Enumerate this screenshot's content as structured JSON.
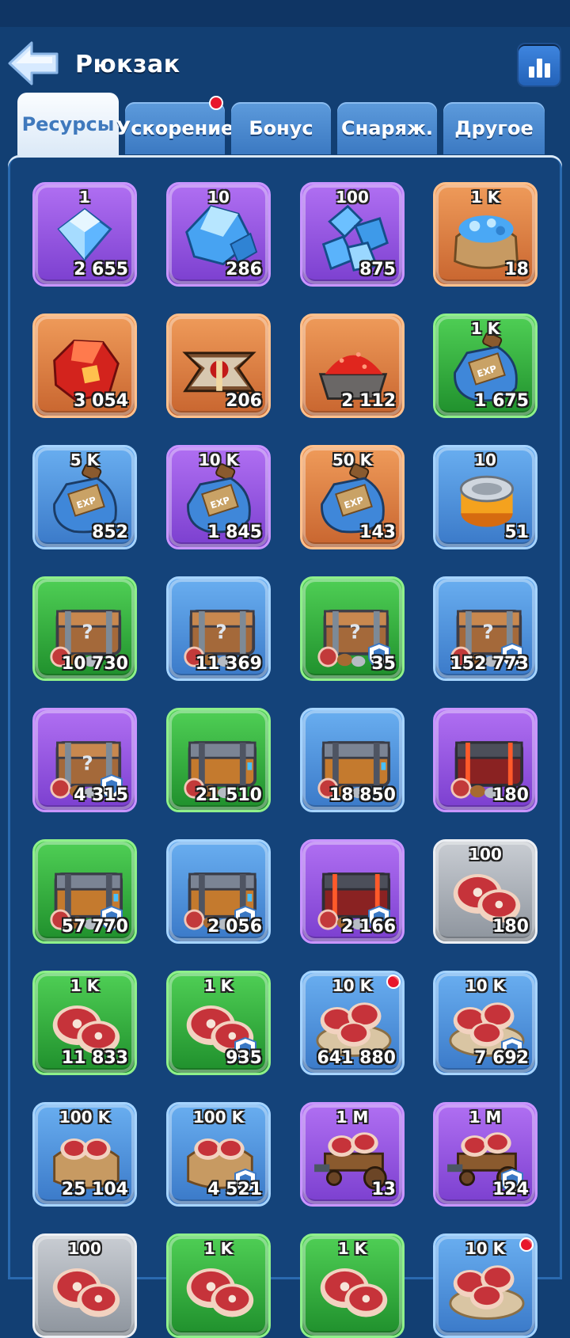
{
  "header": {
    "title": "Рюкзак"
  },
  "tabs": [
    {
      "label": "Ресурсы",
      "active": true,
      "badge": false
    },
    {
      "label": "Ускорение",
      "active": false,
      "badge": true
    },
    {
      "label": "Бонус",
      "active": false,
      "badge": false
    },
    {
      "label": "Снаряж.",
      "active": false,
      "badge": false
    },
    {
      "label": "Другое",
      "active": false,
      "badge": false
    }
  ],
  "colors": {
    "background": "#123f73",
    "tab_active_text": "#3f79bd",
    "badge_red": "#e8162b"
  },
  "items": [
    {
      "icon": "crystal-small-icon",
      "rarity": "purple",
      "amount": "1",
      "count": "2 655",
      "shield": false,
      "dot": false
    },
    {
      "icon": "crystal-medium-icon",
      "rarity": "purple",
      "amount": "10",
      "count": "286",
      "shield": false,
      "dot": false
    },
    {
      "icon": "crystal-pile-icon",
      "rarity": "purple",
      "amount": "100",
      "count": "875",
      "shield": false,
      "dot": false
    },
    {
      "icon": "crystal-sack-icon",
      "rarity": "orange",
      "amount": "1 K",
      "count": "18",
      "shield": false,
      "dot": false
    },
    {
      "icon": "red-ore-icon",
      "rarity": "orange",
      "amount": "",
      "count": "3 054",
      "shield": false,
      "dot": false
    },
    {
      "icon": "anvil-emblem-icon",
      "rarity": "orange",
      "amount": "",
      "count": "206",
      "shield": false,
      "dot": false
    },
    {
      "icon": "red-dust-cart-icon",
      "rarity": "orange",
      "amount": "",
      "count": "2 112",
      "shield": false,
      "dot": false
    },
    {
      "icon": "exp-potion-icon",
      "rarity": "green",
      "amount": "1 K",
      "count": "1 675",
      "shield": false,
      "dot": false
    },
    {
      "icon": "exp-potion-icon",
      "rarity": "blue",
      "amount": "5 K",
      "count": "852",
      "shield": false,
      "dot": false
    },
    {
      "icon": "exp-potion-icon",
      "rarity": "purple",
      "amount": "10 K",
      "count": "1 845",
      "shield": false,
      "dot": false
    },
    {
      "icon": "exp-potion-icon",
      "rarity": "orange",
      "amount": "50 K",
      "count": "143",
      "shield": false,
      "dot": false
    },
    {
      "icon": "tin-can-icon",
      "rarity": "blue",
      "amount": "10",
      "count": "51",
      "shield": false,
      "dot": false
    },
    {
      "icon": "mystery-chest-icon",
      "rarity": "green",
      "amount": "",
      "count": "10 730",
      "shield": false,
      "dot": false
    },
    {
      "icon": "mystery-chest-icon",
      "rarity": "blue",
      "amount": "",
      "count": "11 369",
      "shield": false,
      "dot": false
    },
    {
      "icon": "mystery-chest-icon",
      "rarity": "green",
      "amount": "",
      "count": "35",
      "shield": true,
      "dot": false
    },
    {
      "icon": "mystery-chest-icon",
      "rarity": "blue",
      "amount": "",
      "count": "152 773",
      "shield": true,
      "dot": false
    },
    {
      "icon": "mystery-chest-icon",
      "rarity": "purple",
      "amount": "",
      "count": "4 315",
      "shield": true,
      "dot": false
    },
    {
      "icon": "resource-chest-icon",
      "rarity": "green",
      "amount": "",
      "count": "21 510",
      "shield": false,
      "dot": false
    },
    {
      "icon": "resource-chest-icon",
      "rarity": "blue",
      "amount": "",
      "count": "18 850",
      "shield": false,
      "dot": false
    },
    {
      "icon": "resource-chest-red-icon",
      "rarity": "purple",
      "amount": "",
      "count": "180",
      "shield": false,
      "dot": false
    },
    {
      "icon": "resource-chest-icon",
      "rarity": "green",
      "amount": "",
      "count": "57 770",
      "shield": true,
      "dot": false
    },
    {
      "icon": "resource-chest-icon",
      "rarity": "blue",
      "amount": "",
      "count": "2 056",
      "shield": true,
      "dot": false
    },
    {
      "icon": "resource-chest-red-icon",
      "rarity": "purple",
      "amount": "",
      "count": "2 166",
      "shield": true,
      "dot": false
    },
    {
      "icon": "meat-icon",
      "rarity": "grey",
      "amount": "100",
      "count": "180",
      "shield": false,
      "dot": false
    },
    {
      "icon": "meat-icon",
      "rarity": "green",
      "amount": "1 K",
      "count": "11 833",
      "shield": false,
      "dot": false
    },
    {
      "icon": "meat-icon",
      "rarity": "green",
      "amount": "1 K",
      "count": "935",
      "shield": true,
      "dot": false
    },
    {
      "icon": "meat-plate-icon",
      "rarity": "blue",
      "amount": "10 K",
      "count": "641 880",
      "shield": false,
      "dot": true
    },
    {
      "icon": "meat-plate-icon",
      "rarity": "blue",
      "amount": "10 K",
      "count": "7 692",
      "shield": true,
      "dot": false
    },
    {
      "icon": "meat-sack-icon",
      "rarity": "blue",
      "amount": "100 K",
      "count": "25 104",
      "shield": false,
      "dot": false
    },
    {
      "icon": "meat-sack-icon",
      "rarity": "blue",
      "amount": "100 K",
      "count": "4 521",
      "shield": true,
      "dot": false
    },
    {
      "icon": "meat-cart-icon",
      "rarity": "purple",
      "amount": "1 M",
      "count": "13",
      "shield": false,
      "dot": false
    },
    {
      "icon": "meat-cart-icon",
      "rarity": "purple",
      "amount": "1 M",
      "count": "124",
      "shield": true,
      "dot": false
    },
    {
      "icon": "meat-icon",
      "rarity": "grey",
      "amount": "100",
      "count": "",
      "shield": false,
      "dot": false
    },
    {
      "icon": "meat-icon",
      "rarity": "green",
      "amount": "1 K",
      "count": "",
      "shield": false,
      "dot": false
    },
    {
      "icon": "meat-icon",
      "rarity": "green",
      "amount": "1 K",
      "count": "",
      "shield": false,
      "dot": false
    },
    {
      "icon": "meat-plate-icon",
      "rarity": "blue",
      "amount": "10 K",
      "count": "",
      "shield": false,
      "dot": true
    }
  ]
}
